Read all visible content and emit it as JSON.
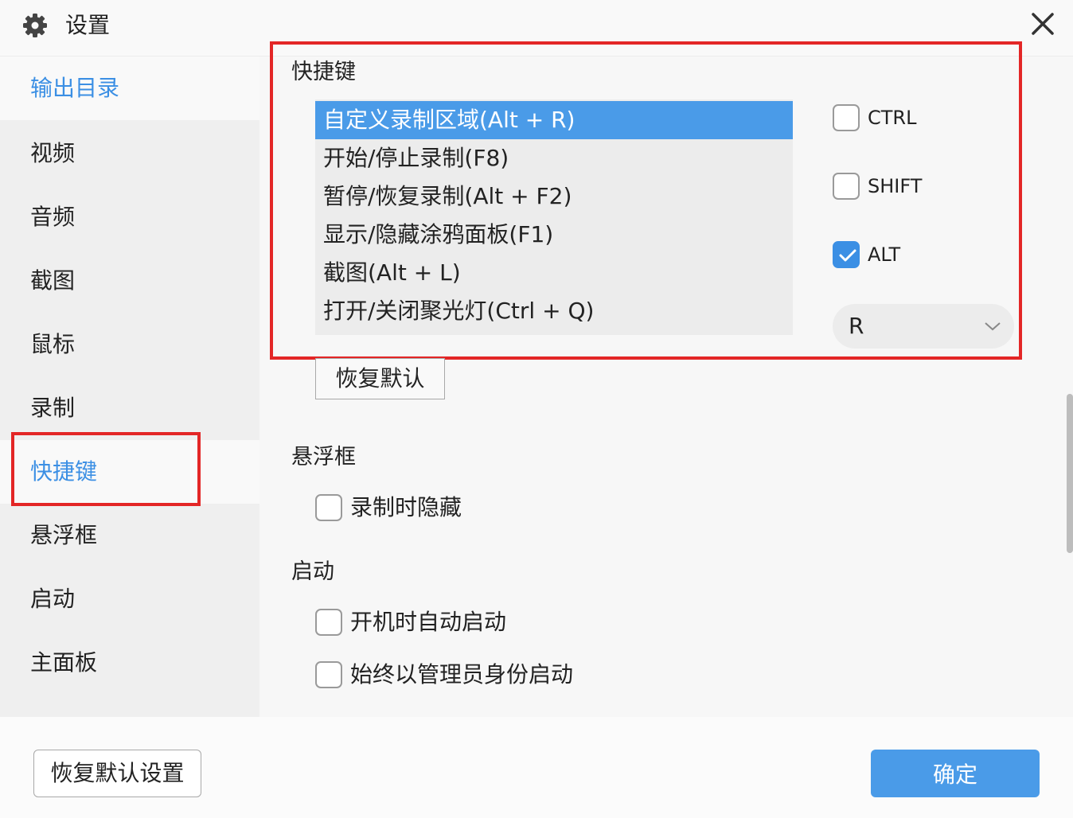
{
  "window": {
    "title": "设置",
    "title_icon": "gear-icon",
    "close_icon": "close-icon"
  },
  "sidebar": {
    "items": [
      {
        "label": "输出目录",
        "active": false
      },
      {
        "label": "视频",
        "active": false
      },
      {
        "label": "音频",
        "active": false
      },
      {
        "label": "截图",
        "active": false
      },
      {
        "label": "鼠标",
        "active": false
      },
      {
        "label": "录制",
        "active": false
      },
      {
        "label": "快捷键",
        "active": true
      },
      {
        "label": "悬浮框",
        "active": false
      },
      {
        "label": "启动",
        "active": false
      },
      {
        "label": "主面板",
        "active": false
      }
    ]
  },
  "hotkeys": {
    "title": "快捷键",
    "items": [
      {
        "label": "自定义录制区域(Alt + R)",
        "selected": true
      },
      {
        "label": "开始/停止录制(F8)",
        "selected": false
      },
      {
        "label": "暂停/恢复录制(Alt + F2)",
        "selected": false
      },
      {
        "label": "显示/隐藏涂鸦面板(F1)",
        "selected": false
      },
      {
        "label": "截图(Alt + L)",
        "selected": false
      },
      {
        "label": "打开/关闭聚光灯(Ctrl + Q)",
        "selected": false
      }
    ],
    "modifiers": [
      {
        "label": "CTRL",
        "checked": false
      },
      {
        "label": "SHIFT",
        "checked": false
      },
      {
        "label": "ALT",
        "checked": true
      }
    ],
    "key": {
      "value": "R",
      "arrow_icon": "chevron-down-icon"
    },
    "restore_label": "恢复默认"
  },
  "float_window": {
    "title": "悬浮框",
    "options": [
      {
        "label": "录制时隐藏",
        "checked": false
      }
    ]
  },
  "startup": {
    "title": "启动",
    "options": [
      {
        "label": "开机时自动启动",
        "checked": false
      },
      {
        "label": "始终以管理员身份启动",
        "checked": false
      }
    ]
  },
  "footer": {
    "restore_all_label": "恢复默认设置",
    "confirm_label": "确定"
  },
  "colors": {
    "accent": "#4a9be8",
    "active_text": "#3b8fe4",
    "highlight_border": "#e32626"
  }
}
